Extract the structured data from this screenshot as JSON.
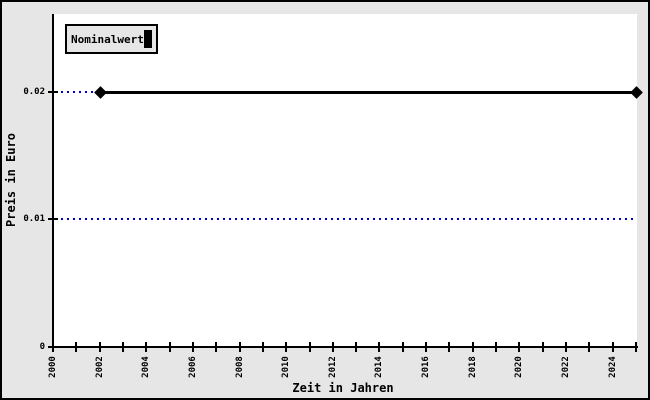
{
  "chart_data": {
    "type": "line",
    "title": "",
    "xlabel": "Zeit in Jahren",
    "ylabel": "Preis in Euro",
    "xlim": [
      2000,
      2025
    ],
    "ylim": [
      0,
      0.0261
    ],
    "grid": "horizontal-dashed",
    "grid_color": "#0000CC",
    "background_color": "#E6E6E6",
    "plot_background_color": "#FFFFFF",
    "legend_position": "top-left",
    "x_ticks": [
      {
        "v": 2000,
        "label": "2000"
      },
      {
        "v": 2001,
        "label": ""
      },
      {
        "v": 2002,
        "label": "2002"
      },
      {
        "v": 2003,
        "label": ""
      },
      {
        "v": 2004,
        "label": "2004"
      },
      {
        "v": 2005,
        "label": ""
      },
      {
        "v": 2006,
        "label": "2006"
      },
      {
        "v": 2007,
        "label": ""
      },
      {
        "v": 2008,
        "label": "2008"
      },
      {
        "v": 2009,
        "label": ""
      },
      {
        "v": 2010,
        "label": "2010"
      },
      {
        "v": 2011,
        "label": ""
      },
      {
        "v": 2012,
        "label": "2012"
      },
      {
        "v": 2013,
        "label": ""
      },
      {
        "v": 2014,
        "label": "2014"
      },
      {
        "v": 2015,
        "label": ""
      },
      {
        "v": 2016,
        "label": "2016"
      },
      {
        "v": 2017,
        "label": ""
      },
      {
        "v": 2018,
        "label": "2018"
      },
      {
        "v": 2019,
        "label": ""
      },
      {
        "v": 2020,
        "label": "2020"
      },
      {
        "v": 2021,
        "label": ""
      },
      {
        "v": 2022,
        "label": "2022"
      },
      {
        "v": 2023,
        "label": ""
      },
      {
        "v": 2024,
        "label": "2024"
      },
      {
        "v": 2025,
        "label": ""
      }
    ],
    "y_ticks": [
      {
        "v": 0,
        "label": "0"
      },
      {
        "v": 0.01,
        "label": "0.01"
      },
      {
        "v": 0.02,
        "label": "0.02"
      }
    ],
    "gridlines_y": [
      0.01,
      0.02
    ],
    "series": [
      {
        "name": "Nominalwert",
        "color": "#000000",
        "marker": "diamond",
        "x": [
          2002,
          2025
        ],
        "y": [
          0.02,
          0.02
        ]
      }
    ]
  }
}
